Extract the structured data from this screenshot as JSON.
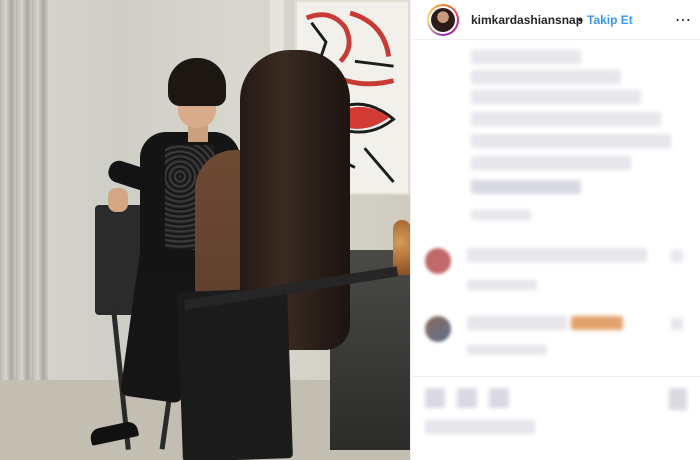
{
  "post": {
    "username": "kimkardashiansnap",
    "separator": "•",
    "follow_label": "Takip Et",
    "more_icon": "more-options-icon"
  },
  "caption": {
    "note": "",
    "content_pixelated": true
  },
  "comments": [
    {
      "pixelated": true
    },
    {
      "pixelated": true
    }
  ],
  "colors": {
    "follow": "#3897f0",
    "text": "#262626",
    "divider": "#efefef"
  }
}
